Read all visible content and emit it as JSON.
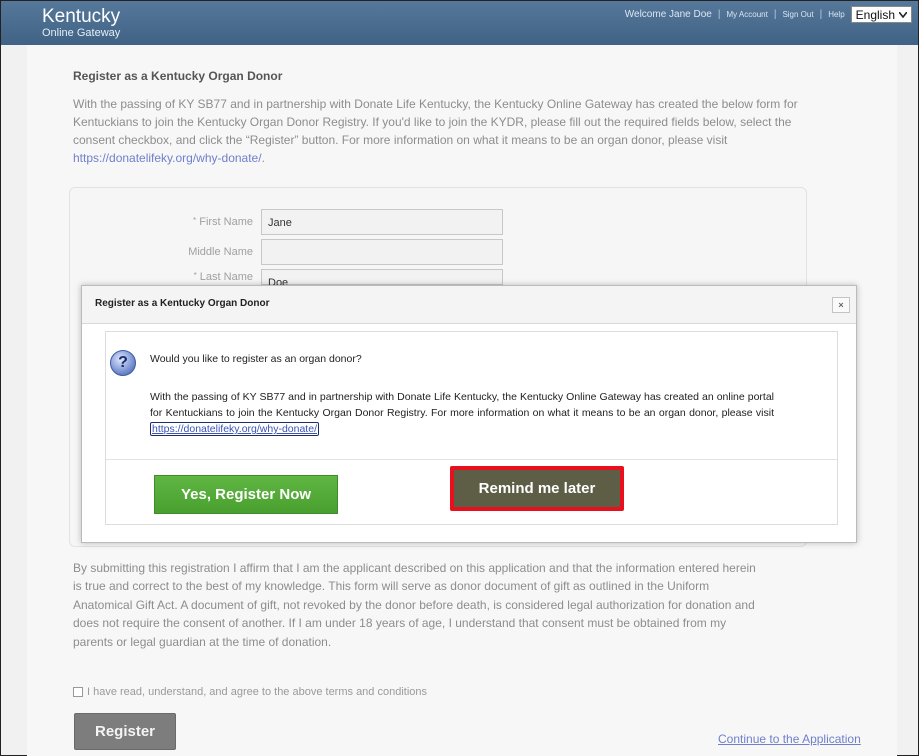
{
  "header": {
    "brand_main": "Kentucky",
    "brand_sub": "Online Gateway",
    "welcome": "Welcome Jane Doe",
    "my_account": "My Account",
    "sign_out": "Sign Out",
    "help": "Help",
    "language": "English",
    "separator": "|"
  },
  "page": {
    "title": "Register as a Kentucky Organ Donor",
    "intro": "With the passing of KY SB77 and in partnership with Donate Life Kentucky, the Kentucky Online Gateway has created the below form for Kentuckians to join the Kentucky Organ Donor Registry. If you'd like to join the KYDR, please fill out the required fields below, select the consent checkbox, and click the “Register” button. For more information on what it means to be an organ donor, please visit ",
    "intro_link": "https://donatelifeky.org/why-donate/",
    "intro_end": ".",
    "fields": {
      "first_name_label": "First Name",
      "first_name_value": "Jane",
      "middle_name_label": "Middle Name",
      "middle_name_value": "",
      "last_name_label": "Last Name",
      "last_name_value": "Doe",
      "required_mark": "*"
    },
    "disclaimer": "By submitting this registration I affirm that I am the applicant described on this application and that the information entered herein is true and correct to the best of my knowledge. This form will serve as donor document of gift as outlined in the Uniform Anatomical Gift Act. A document of gift, not revoked by the donor before death, is considered legal authorization for donation and does not require the consent of another. If I am under 18 years of age, I understand that consent must be obtained from my parents or legal guardian at the time of donation.",
    "terms_label": "I have read, understand, and agree to the above terms and conditions",
    "register_label": "Register",
    "continue_label": "Continue to the Application"
  },
  "modal": {
    "title": "Register as a Kentucky Organ Donor",
    "close_label": "×",
    "icon": "question-icon",
    "question": "Would you like to register as an organ donor?",
    "text": "With the passing of KY SB77 and in partnership with Donate Life Kentucky, the Kentucky Online Gateway has created an online portal for Kentuckians to join the Kentucky Organ Donor Registry. For more information on what it means to be an organ donor, please visit ",
    "link": "https://donatelifeky.org/why-donate/",
    "yes_label": "Yes, Register Now",
    "remind_label": "Remind me later"
  },
  "colors": {
    "header_bg": "#4a6b8c",
    "yes_button": "#55aa38",
    "remind_button": "#5e5e46",
    "highlight_outline": "#e8101c"
  }
}
